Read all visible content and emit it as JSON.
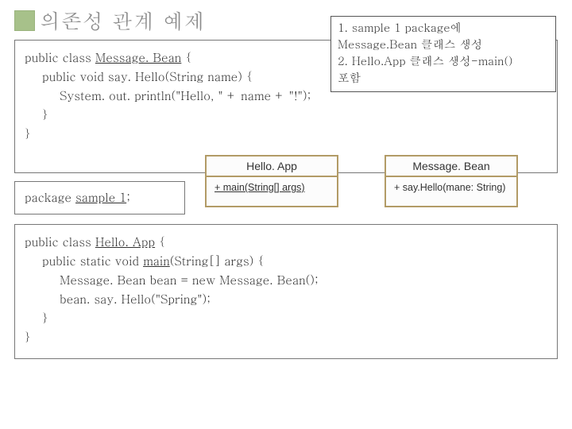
{
  "title": "의존성 관계 예제",
  "note": {
    "line1": "1. sample 1 package에",
    "line2": "Message.Bean 클래스 생성",
    "line3": "2. Hello.App 클래스 생성-main()",
    "line4": "포함"
  },
  "code1": {
    "l1a": "public class ",
    "l1b": "Message. Bean",
    "l1c": " {",
    "l2": "public void say. Hello(String name) {",
    "l3": "System. out. println(\"Hello, \" + name + \"!\");",
    "l4": "}",
    "l5": "}"
  },
  "pkg": {
    "a": "package ",
    "b": "sample 1",
    "c": ";"
  },
  "code2": {
    "l1a": "public class ",
    "l1b": "Hello. App",
    "l1c": " {",
    "l2a": "public static void ",
    "l2b": "main",
    "l2c": "(String[] args) {",
    "l3": "Message. Bean bean = new Message. Bean();",
    "l4": "bean. say. Hello(\"Spring\");",
    "l5": "}",
    "l6": "}"
  },
  "uml": {
    "left_name": "Hello. App",
    "left_method": "+ main(String[] args)",
    "right_name": "Message. Bean",
    "right_method": "+ say.Hello(mane: String)"
  }
}
